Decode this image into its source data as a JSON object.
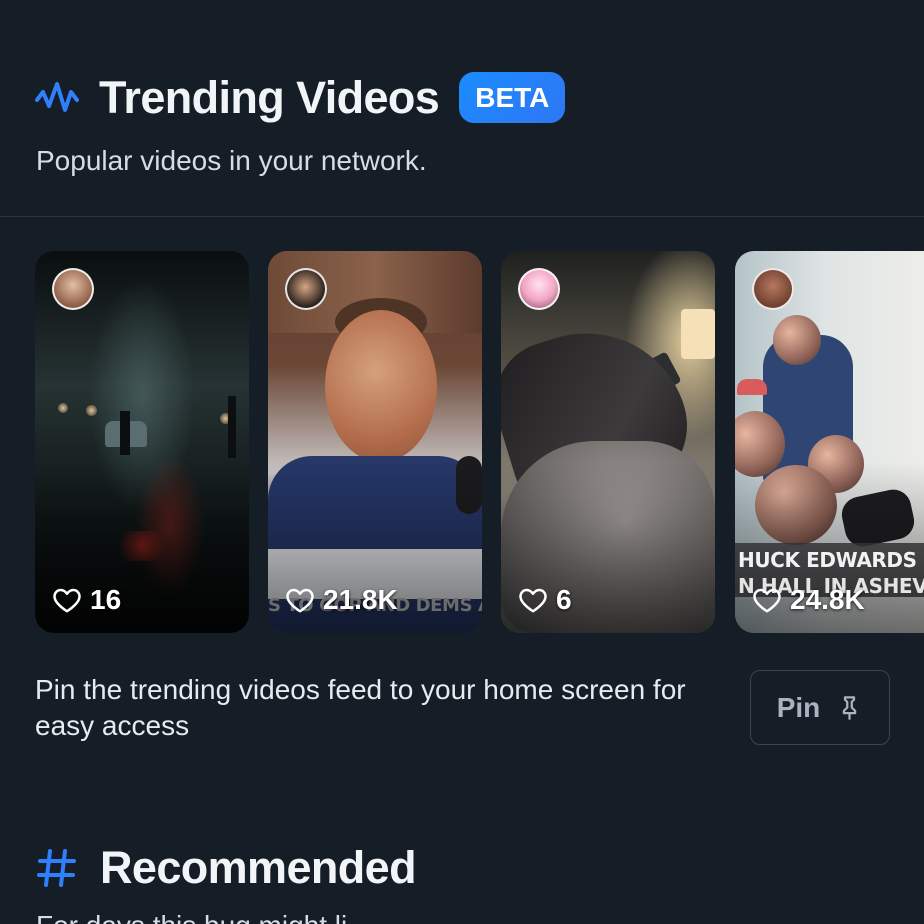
{
  "trending": {
    "title": "Trending Videos",
    "badge": "BETA",
    "subtitle": "Popular videos in your network."
  },
  "videos": [
    {
      "likes": "16",
      "caption_top": "",
      "caption_bottom": ""
    },
    {
      "likes": "21.8K",
      "caption_top": "",
      "caption_bottom": "S TO GOP AND DEMS ARE PI"
    },
    {
      "likes": "6",
      "caption_top": "",
      "caption_bottom": ""
    },
    {
      "likes": "24.8K",
      "caption_top": "HUCK EDWARDS (I",
      "caption_bottom": "N HALL IN ASHEVI"
    }
  ],
  "pin": {
    "text": "Pin the trending videos feed to your home screen for easy access",
    "button_label": "Pin"
  },
  "recommended": {
    "title": "Recommended",
    "hint": "For days this bug might li"
  },
  "colors": {
    "background": "#151d27",
    "accent": "#2f80ff",
    "text": "#f2f5f8",
    "muted": "#d7dde4"
  },
  "icons": {
    "trending": "pulse-icon",
    "badge": "beta-badge",
    "likes": "heart-icon",
    "pin": "pin-icon",
    "recommended": "hash-icon"
  }
}
